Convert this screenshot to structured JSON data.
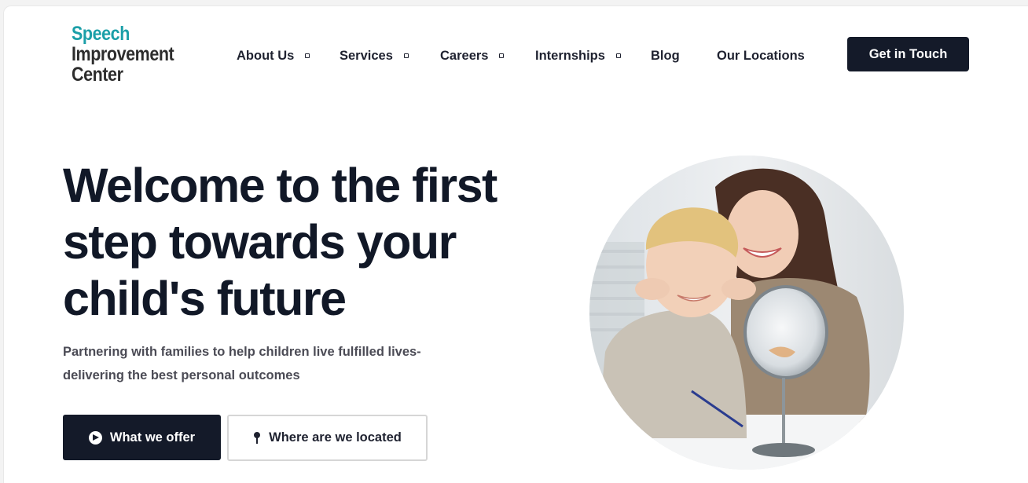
{
  "header": {
    "logo": {
      "line1": "Speech",
      "line2": "Improvement",
      "line3": "Center"
    },
    "nav": [
      {
        "label": "About Us",
        "has_dropdown": true
      },
      {
        "label": "Services",
        "has_dropdown": true
      },
      {
        "label": "Careers",
        "has_dropdown": true
      },
      {
        "label": "Internships",
        "has_dropdown": true
      },
      {
        "label": "Blog",
        "has_dropdown": false
      },
      {
        "label": "Our Locations",
        "has_dropdown": false
      }
    ],
    "cta_label": "Get in Touch"
  },
  "hero": {
    "title_line1": "Welcome to the first",
    "title_line2": "step towards your",
    "title_line3": "child's future",
    "subtitle_line1": "Partnering with families to help children live fulfilled lives-",
    "subtitle_line2": "delivering the best personal outcomes",
    "primary_button": "What we offer",
    "secondary_button": "Where are we located"
  },
  "colors": {
    "logo_accent": "#1b9fa8",
    "dark": "#141a29",
    "text": "#111827"
  },
  "icons": {
    "primary_button_icon": "arrow-circle-right-icon",
    "secondary_button_icon": "map-pin-icon",
    "dropdown_icon": "chevron-down-icon"
  }
}
